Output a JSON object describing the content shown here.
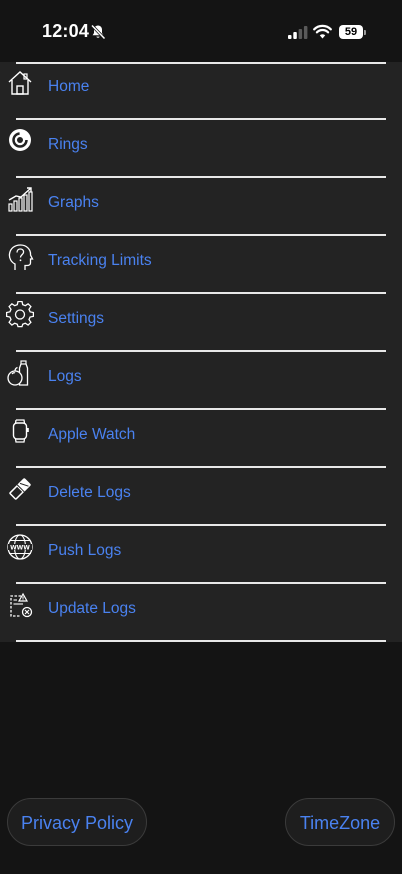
{
  "status_bar": {
    "time": "12:04",
    "battery": "59",
    "icons": [
      "bell-slash-icon",
      "cellular-signal-icon",
      "wifi-icon",
      "battery-icon"
    ]
  },
  "menu": {
    "items": [
      {
        "label": "Home",
        "icon": "home-icon"
      },
      {
        "label": "Rings",
        "icon": "rings-icon"
      },
      {
        "label": "Graphs",
        "icon": "graphs-icon"
      },
      {
        "label": "Tracking Limits",
        "icon": "head-question-icon"
      },
      {
        "label": "Settings",
        "icon": "gear-icon"
      },
      {
        "label": "Logs",
        "icon": "food-logs-icon"
      },
      {
        "label": "Apple Watch",
        "icon": "watch-icon"
      },
      {
        "label": "Delete Logs",
        "icon": "eraser-icon"
      },
      {
        "label": "Push Logs",
        "icon": "globe-www-icon"
      },
      {
        "label": "Update Logs",
        "icon": "document-warning-icon"
      }
    ]
  },
  "footer": {
    "privacy_label": "Privacy Policy",
    "timezone_label": "TimeZone"
  },
  "colors": {
    "background": "#141414",
    "panel": "#232323",
    "accent": "#4a82f0",
    "divider": "#e8e8e8"
  }
}
